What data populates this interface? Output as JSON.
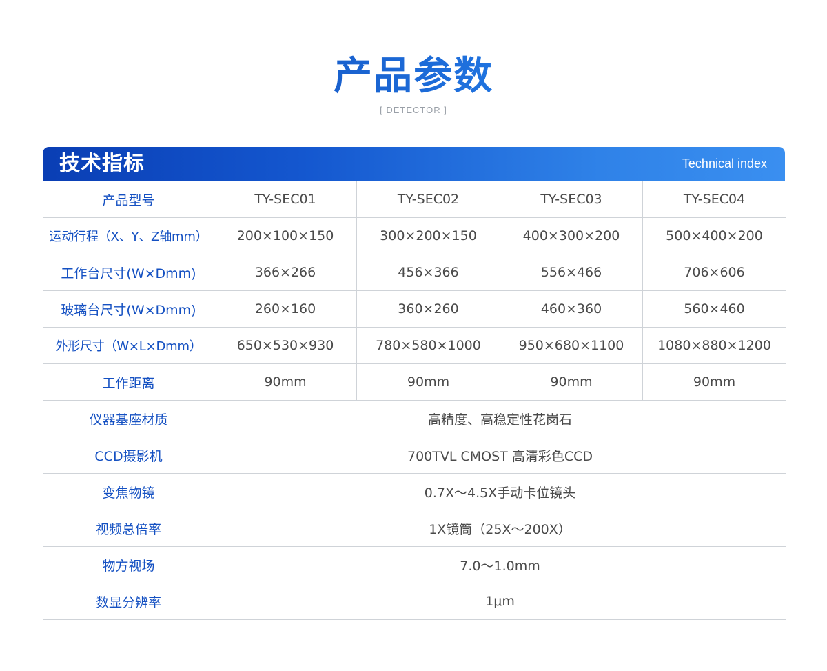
{
  "hero": {
    "title": "产品参数",
    "subtitle": "[ DETECTOR ]"
  },
  "band": {
    "title": "技术指标",
    "subtitle": "Technical index"
  },
  "header_row": {
    "label": "产品型号",
    "models": [
      "TY-SEC01",
      "TY-SEC02",
      "TY-SEC03",
      "TY-SEC04"
    ]
  },
  "model_rows": [
    {
      "label": "运动行程（X、Y、Z轴mm）",
      "values": [
        "200×100×150",
        "300×200×150",
        "400×300×200",
        "500×400×200"
      ]
    },
    {
      "label": "工作台尺寸(W×Dmm)",
      "values": [
        "366×266",
        "456×366",
        "556×466",
        "706×606"
      ]
    },
    {
      "label": "玻璃台尺寸(W×Dmm)",
      "values": [
        "260×160",
        "360×260",
        "460×360",
        "560×460"
      ]
    },
    {
      "label": "外形尺寸（W×L×Dmm）",
      "values": [
        "650×530×930",
        "780×580×1000",
        "950×680×1100",
        "1080×880×1200"
      ]
    },
    {
      "label": "工作距离",
      "values": [
        "90mm",
        "90mm",
        "90mm",
        "90mm"
      ]
    }
  ],
  "common_rows": [
    {
      "label": "仪器基座材质",
      "value": "高精度、高稳定性花岗石"
    },
    {
      "label": "CCD摄影机",
      "value": "700TVL CMOST 高清彩色CCD"
    },
    {
      "label": "变焦物镜",
      "value": "0.7X～4.5X手动卡位镜头"
    },
    {
      "label": "视频总倍率",
      "value": "1X镜筒（25X～200X）"
    },
    {
      "label": "物方视场",
      "value": "7.0～1.0mm"
    },
    {
      "label": "数显分辨率",
      "value": "1μm"
    }
  ],
  "colors": {
    "accent": "#1450c2",
    "band_start": "#0a3eb4",
    "band_end": "#3a8ff0",
    "border": "#cfd3d8",
    "text": "#4a4a4a"
  }
}
